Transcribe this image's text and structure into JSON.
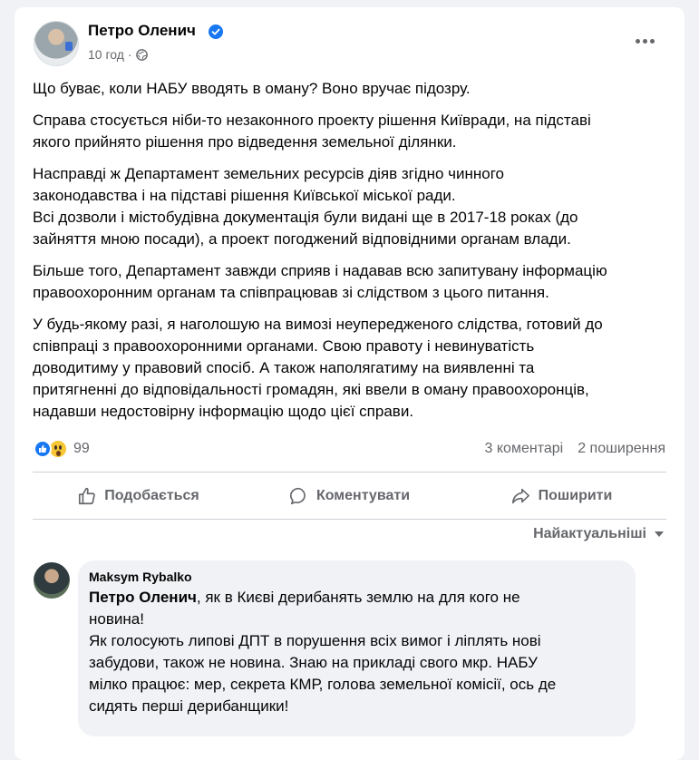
{
  "post": {
    "author": "Петро Оленич",
    "time": "10 год",
    "paragraphs": [
      "Що буває, коли НАБУ вводять в оману? Воно вручає підозру.",
      "Справа стосується ніби-то незаконного проекту рішення Київради, на підставі\nякого прийнято рішення про відведення земельної ділянки.",
      "Насправді ж Департамент земельних ресурсів діяв згідно чинного\nзаконодавства і на підставі рішення Київської міської ради.\nВсі дозволи і містобудівна документація були видані ще в 2017-18 роках (до\nзайняття мною посади), а проект погоджений відповідними органам влади.",
      "Більше того, Департамент завжди сприяв і надавав всю запитувану інформацію\nправоохоронним органам та співпрацював зі слідством з цього питання.",
      "У будь-якому разі, я наголошую на вимозі неупередженого слідства, готовий до\nспівпраці з правоохоронними органами. Свою правоту і невинуватість\nдоводитиму у правовий спосіб. А також наполягатиму на виявленні та\nпритягненні до відповідальності громадян, які ввели в оману правоохоронців,\nнадавши недостовірну інформацію щодо цієї справи."
    ],
    "reaction_count": "99",
    "comments_count": "3 коментарі",
    "shares_count": "2 поширення"
  },
  "actions": {
    "like": "Подобається",
    "comment": "Коментувати",
    "share": "Поширити"
  },
  "sort_label": "Найактуальніші",
  "comment": {
    "author": "Maksym Rybalko",
    "mention": "Петро Оленич",
    "text": ", як в Києві дерибанять землю на для кого не\nновина!\nЯк голосують липові ДПТ в порушення всіх вимог і ліплять нові\nзабудови, також не новина. Знаю на прикладі свого мкр. НАБУ\nмілко працює: мер, секрета КМР, голова земельної комісії, ось де\nсидять перші дерибанщики!"
  },
  "colors": {
    "accent": "#1877f2",
    "secondary_text": "#65676b",
    "background": "#f0f2f5"
  }
}
